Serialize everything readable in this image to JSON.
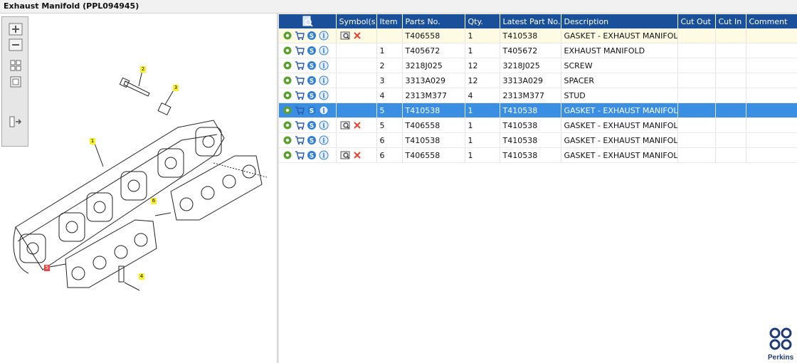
{
  "window": {
    "title": "Exhaust Manifold (PPL094945)"
  },
  "toolbar": {
    "zoom_in": "zoom-in-icon",
    "zoom_out": "zoom-out-icon",
    "fit": "fit-to-window-icon",
    "actual_size": "actual-size-icon",
    "toggle_list": "toggle-list-icon"
  },
  "drawing": {
    "callouts": [
      "1",
      "2",
      "3",
      "4",
      "5",
      "6"
    ]
  },
  "table": {
    "headers": {
      "tools": "search-icon",
      "symbols": "Symbol(s)",
      "item": "Item",
      "part_no": "Parts No.",
      "qty": "Qty.",
      "latest": "Latest Part No.",
      "description": "Description",
      "cut_out": "Cut Out",
      "cut_in": "Cut In",
      "comment": "Comment"
    },
    "rows": [
      {
        "item": "",
        "part_no": "T406558",
        "qty": "1",
        "latest": "T410538",
        "description": "GASKET - EXHAUST MANIFOLD",
        "cut_out": "",
        "cut_in": "",
        "comment": ""
      },
      {
        "item": "1",
        "part_no": "T405672",
        "qty": "1",
        "latest": "T405672",
        "description": "EXHAUST MANIFOLD",
        "cut_out": "",
        "cut_in": "",
        "comment": ""
      },
      {
        "item": "2",
        "part_no": "3218J025",
        "qty": "12",
        "latest": "3218J025",
        "description": "SCREW",
        "cut_out": "",
        "cut_in": "",
        "comment": ""
      },
      {
        "item": "3",
        "part_no": "3313A029",
        "qty": "12",
        "latest": "3313A029",
        "description": "SPACER",
        "cut_out": "",
        "cut_in": "",
        "comment": ""
      },
      {
        "item": "4",
        "part_no": "2313M377",
        "qty": "4",
        "latest": "2313M377",
        "description": "STUD",
        "cut_out": "",
        "cut_in": "",
        "comment": ""
      },
      {
        "item": "5",
        "part_no": "T410538",
        "qty": "1",
        "latest": "T410538",
        "description": "GASKET - EXHAUST MANIFOLD",
        "cut_out": "",
        "cut_in": "",
        "comment": ""
      },
      {
        "item": "5",
        "part_no": "T406558",
        "qty": "1",
        "latest": "T410538",
        "description": "GASKET - EXHAUST MANIFOLD",
        "cut_out": "",
        "cut_in": "",
        "comment": ""
      },
      {
        "item": "6",
        "part_no": "T410538",
        "qty": "1",
        "latest": "T410538",
        "description": "GASKET - EXHAUST MANIFOLD",
        "cut_out": "",
        "cut_in": "",
        "comment": ""
      },
      {
        "item": "6",
        "part_no": "T406558",
        "qty": "1",
        "latest": "T410538",
        "description": "GASKET - EXHAUST MANIFOLD",
        "cut_out": "",
        "cut_in": "",
        "comment": ""
      }
    ],
    "row_icons": [
      "gear-icon",
      "cart-icon",
      "supersession-icon",
      "info-icon"
    ],
    "symbol_icons": [
      "superseded-book-icon",
      "remove-icon"
    ]
  },
  "colors": {
    "header_bg": "#1a4f9a",
    "selected_row": "#3b8fe3",
    "alt_row": "#fefbe5",
    "brand": "#1f3b77"
  },
  "brand": {
    "logo_text": "Perkins"
  }
}
